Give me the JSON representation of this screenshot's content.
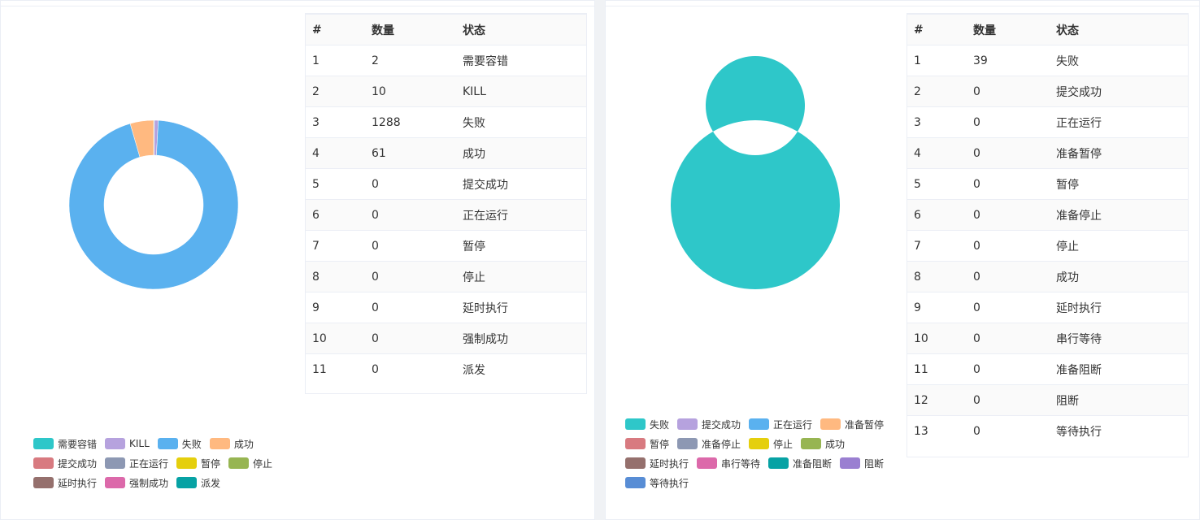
{
  "left": {
    "table": {
      "headers": [
        "#",
        "数量",
        "状态"
      ],
      "rows": [
        [
          "1",
          "2",
          "需要容错"
        ],
        [
          "2",
          "10",
          "KILL"
        ],
        [
          "3",
          "1288",
          "失败"
        ],
        [
          "4",
          "61",
          "成功"
        ],
        [
          "5",
          "0",
          "提交成功"
        ],
        [
          "6",
          "0",
          "正在运行"
        ],
        [
          "7",
          "0",
          "暂停"
        ],
        [
          "8",
          "0",
          "停止"
        ],
        [
          "9",
          "0",
          "延时执行"
        ],
        [
          "10",
          "0",
          "强制成功"
        ],
        [
          "11",
          "0",
          "派发"
        ]
      ]
    },
    "chart_data": {
      "type": "pie",
      "labels": [
        "需要容错",
        "KILL",
        "失败",
        "成功",
        "提交成功",
        "正在运行",
        "暂停",
        "停止",
        "延时执行",
        "强制成功",
        "派发"
      ],
      "values": [
        2,
        10,
        1288,
        61,
        0,
        0,
        0,
        0,
        0,
        0,
        0
      ],
      "colors": [
        "#2ec7c9",
        "#b6a2de",
        "#5ab1ef",
        "#ffb980",
        "#d87a80",
        "#8d98b3",
        "#e5cf0d",
        "#97b552",
        "#95706d",
        "#dc69aa",
        "#07a2a4"
      ],
      "donut": true,
      "legend": "bottom"
    }
  },
  "right": {
    "table": {
      "headers": [
        "#",
        "数量",
        "状态"
      ],
      "rows": [
        [
          "1",
          "39",
          "失败"
        ],
        [
          "2",
          "0",
          "提交成功"
        ],
        [
          "3",
          "0",
          "正在运行"
        ],
        [
          "4",
          "0",
          "准备暂停"
        ],
        [
          "5",
          "0",
          "暂停"
        ],
        [
          "6",
          "0",
          "准备停止"
        ],
        [
          "7",
          "0",
          "停止"
        ],
        [
          "8",
          "0",
          "成功"
        ],
        [
          "9",
          "0",
          "延时执行"
        ],
        [
          "10",
          "0",
          "串行等待"
        ],
        [
          "11",
          "0",
          "准备阻断"
        ],
        [
          "12",
          "0",
          "阻断"
        ],
        [
          "13",
          "0",
          "等待执行"
        ]
      ]
    },
    "chart_data": {
      "type": "pie",
      "labels": [
        "失败",
        "提交成功",
        "正在运行",
        "准备暂停",
        "暂停",
        "准备停止",
        "停止",
        "成功",
        "延时执行",
        "串行等待",
        "准备阻断",
        "阻断",
        "等待执行"
      ],
      "values": [
        39,
        0,
        0,
        0,
        0,
        0,
        0,
        0,
        0,
        0,
        0,
        0,
        0
      ],
      "colors": [
        "#2ec7c9",
        "#b6a2de",
        "#5ab1ef",
        "#ffb980",
        "#d87a80",
        "#8d98b3",
        "#e5cf0d",
        "#97b552",
        "#95706d",
        "#dc69aa",
        "#07a2a4",
        "#9a7fd1",
        "#588dd5"
      ],
      "donut": true,
      "legend": "bottom"
    }
  }
}
